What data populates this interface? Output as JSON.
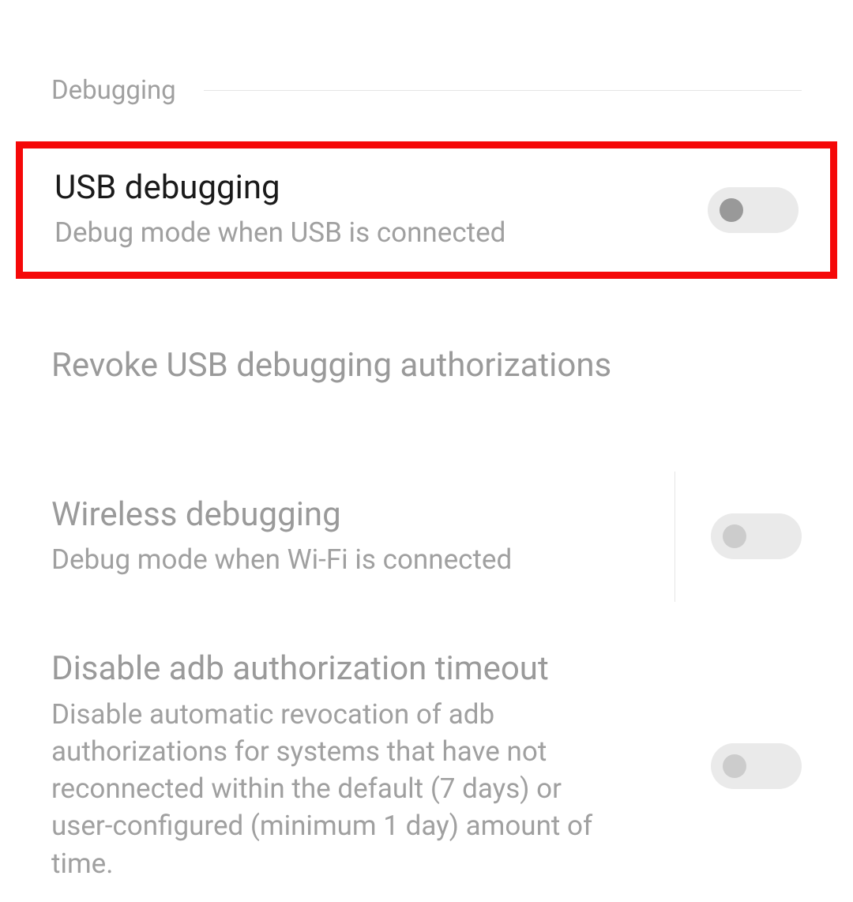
{
  "section": {
    "title": "Debugging"
  },
  "usb_debugging": {
    "title": "USB debugging",
    "desc": "Debug mode when USB is connected",
    "enabled": false
  },
  "revoke": {
    "title": "Revoke USB debugging authorizations"
  },
  "wireless_debugging": {
    "title": "Wireless debugging",
    "desc": "Debug mode when Wi-Fi is connected",
    "enabled": false
  },
  "adb_timeout": {
    "title": "Disable adb authorization timeout",
    "desc": "Disable automatic revocation of adb authorizations for systems that have not reconnected within the default (7 days) or user-configured (minimum 1 day) amount of time.",
    "enabled": false
  }
}
